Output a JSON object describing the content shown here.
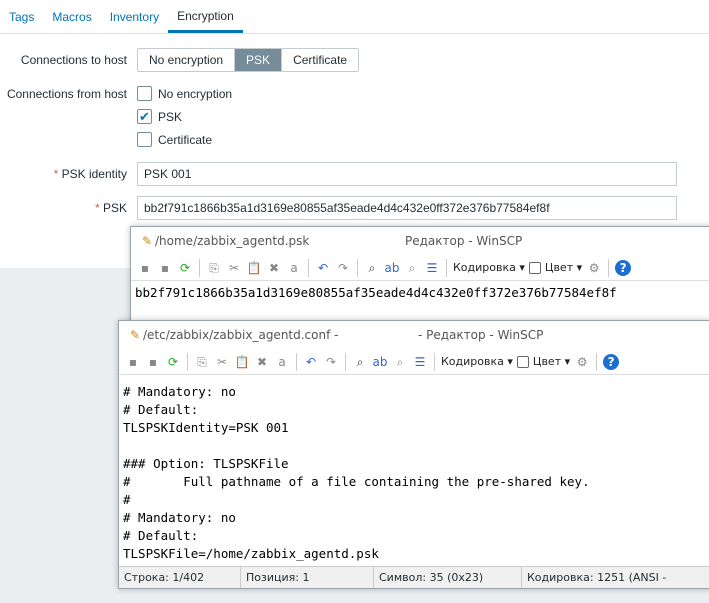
{
  "tabs": [
    "Tags",
    "Macros",
    "Inventory",
    "Encryption"
  ],
  "form": {
    "conn_to_label": "Connections to host",
    "conn_to_options": [
      "No encryption",
      "PSK",
      "Certificate"
    ],
    "conn_from_label": "Connections from host",
    "conn_from_options": [
      {
        "label": "No encryption",
        "checked": false
      },
      {
        "label": "PSK",
        "checked": true
      },
      {
        "label": "Certificate",
        "checked": false
      }
    ],
    "psk_identity_label": "PSK identity",
    "psk_identity": "PSK 001",
    "psk_label": "PSK",
    "psk": "bb2f791c1866b35a1d3169e80855af35eade4d4c432e0ff372e376b77584ef8f",
    "required": "*"
  },
  "win1": {
    "path": "/home/zabbix_agentd.psk",
    "title": "Редактор - WinSCP",
    "encoding": "Кодировка",
    "color": "Цвет",
    "content": "bb2f791c1866b35a1d3169e80855af35eade4d4c432e0ff372e376b77584ef8f"
  },
  "win2": {
    "path": "/etc/zabbix/zabbix_agentd.conf -",
    "title": "- Редактор - WinSCP",
    "encoding": "Кодировка",
    "color": "Цвет",
    "lines": [
      "# Mandatory: no",
      "# Default:",
      "TLSPSKIdentity=PSK 001",
      "",
      "### Option: TLSPSKFile",
      "#       Full pathname of a file containing the pre-shared key.",
      "#",
      "# Mandatory: no",
      "# Default:",
      "TLSPSKFile=/home/zabbix_agentd.psk"
    ],
    "status": [
      "Строка: 1/402",
      "Позиция: 1",
      "Символ: 35 (0x23)",
      "Кодировка: 1251  (ANSI -"
    ]
  }
}
